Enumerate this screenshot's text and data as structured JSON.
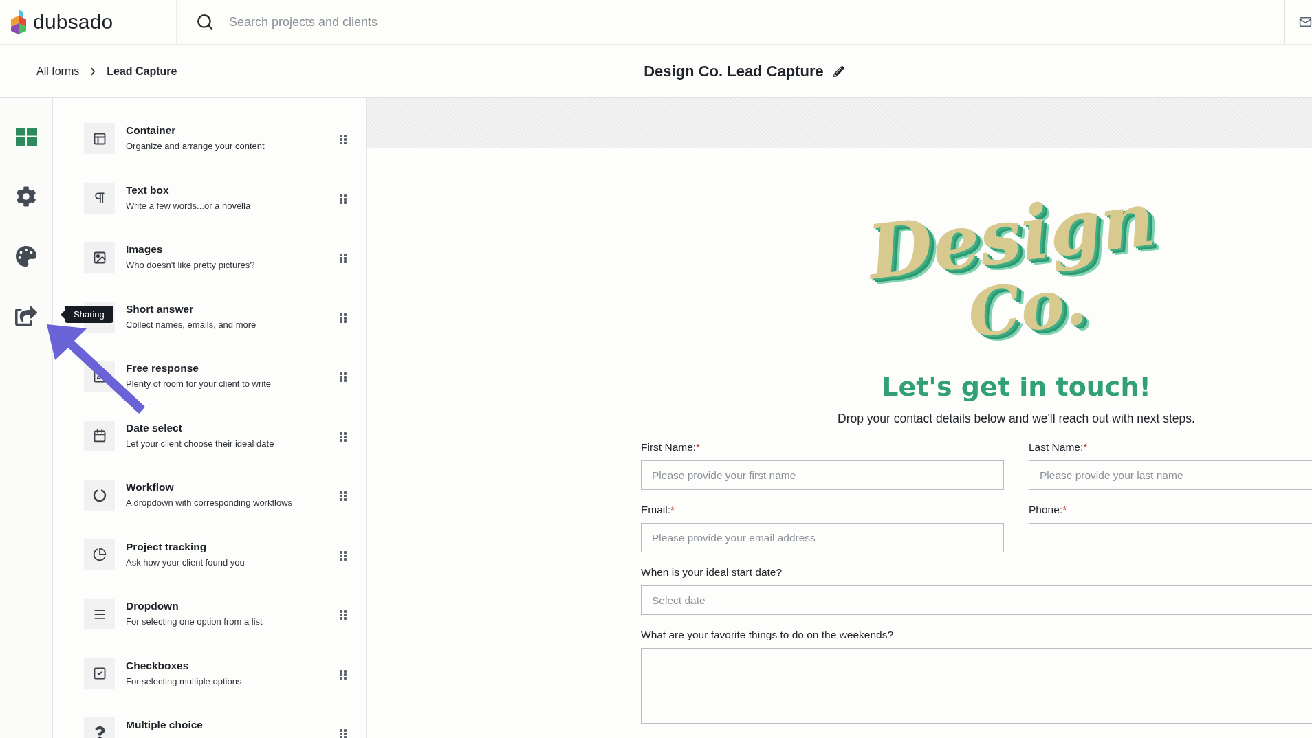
{
  "brand": {
    "name": "dubsado"
  },
  "search": {
    "placeholder": "Search projects and clients"
  },
  "breadcrumb": [
    {
      "label": "All forms",
      "current": false
    },
    {
      "label": "Lead Capture",
      "current": true
    }
  ],
  "form_title": "Design Co. Lead Capture",
  "rail": [
    {
      "kind": "layout",
      "selected": true
    },
    {
      "kind": "settings",
      "selected": false
    },
    {
      "kind": "theme",
      "selected": false
    },
    {
      "kind": "sharing",
      "selected": false
    }
  ],
  "tooltip": "Sharing",
  "elements": [
    {
      "kind": "container",
      "title": "Container",
      "description": "Organize and arrange your content"
    },
    {
      "kind": "text",
      "title": "Text box",
      "description": "Write a few words...or a novella"
    },
    {
      "kind": "image",
      "title": "Images",
      "description": "Who doesn't like pretty pictures?"
    },
    {
      "kind": "short",
      "title": "Short answer",
      "description": "Collect names, emails, and more"
    },
    {
      "kind": "free",
      "title": "Free response",
      "description": "Plenty of room for your client to write"
    },
    {
      "kind": "date",
      "title": "Date select",
      "description": "Let your client choose their ideal date"
    },
    {
      "kind": "workflow",
      "title": "Workflow",
      "description": "A dropdown with corresponding workflows"
    },
    {
      "kind": "tracking",
      "title": "Project tracking",
      "description": "Ask how your client found you"
    },
    {
      "kind": "dropdown",
      "title": "Dropdown",
      "description": "For selecting one option from a list"
    },
    {
      "kind": "checkbox",
      "title": "Checkboxes",
      "description": "For selecting multiple options"
    },
    {
      "kind": "choice",
      "title": "Multiple choice"
    }
  ],
  "preview": {
    "logo_lines": [
      "Design",
      "Co."
    ],
    "heading": "Let's get in touch!",
    "intro": "Drop your contact details below and we'll reach out with next steps.",
    "rows": [
      [
        {
          "kind": "text",
          "label": "First Name:",
          "required_mark": "*",
          "placeholder": "Please provide your first name"
        },
        {
          "kind": "text",
          "label": "Last Name:",
          "required_mark": "*",
          "placeholder": "Please provide your last name"
        }
      ],
      [
        {
          "kind": "text",
          "label": "Email:",
          "required_mark": "*",
          "placeholder": "Please provide your email address"
        },
        {
          "kind": "text",
          "label": "Phone:",
          "required_mark": "*"
        }
      ],
      [
        {
          "kind": "text",
          "label": "When is your ideal start date?",
          "placeholder": "Select date"
        }
      ],
      [
        {
          "kind": "textarea",
          "label": "What are your favorite things to do on the weekends?"
        }
      ]
    ]
  }
}
